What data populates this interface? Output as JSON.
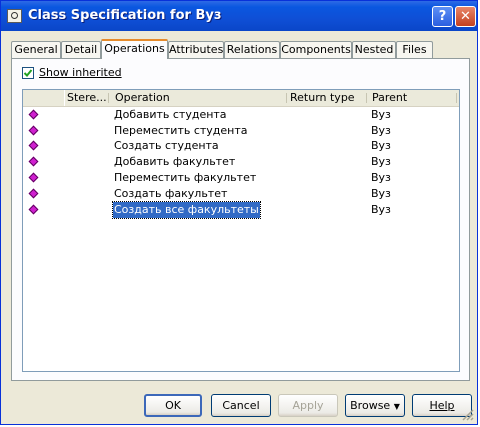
{
  "window": {
    "title": "Class Specification for Вуз"
  },
  "tabs": [
    {
      "label": "General"
    },
    {
      "label": "Detail"
    },
    {
      "label": "Operations"
    },
    {
      "label": "Attributes"
    },
    {
      "label": "Relations"
    },
    {
      "label": "Components"
    },
    {
      "label": "Nested"
    },
    {
      "label": "Files"
    }
  ],
  "active_tab": "Operations",
  "show_inherited": {
    "label": "Show inherited",
    "checked": true
  },
  "table": {
    "columns": [
      "Stere...",
      "Operation",
      "Return type",
      "Parent"
    ],
    "rows": [
      {
        "stereotype": "",
        "operation": "Добавить студента",
        "return_type": "",
        "parent": "Вуз"
      },
      {
        "stereotype": "",
        "operation": "Переместить студента",
        "return_type": "",
        "parent": "Вуз"
      },
      {
        "stereotype": "",
        "operation": "Создать студента",
        "return_type": "",
        "parent": "Вуз"
      },
      {
        "stereotype": "",
        "operation": "Добавить факультет",
        "return_type": "",
        "parent": "Вуз"
      },
      {
        "stereotype": "",
        "operation": "Переместить факультет",
        "return_type": "",
        "parent": "Вуз"
      },
      {
        "stereotype": "",
        "operation": "Создать факультет",
        "return_type": "",
        "parent": "Вуз"
      },
      {
        "stereotype": "",
        "operation": "Создать все факультеты",
        "return_type": "",
        "parent": "Вуз",
        "selected": true
      }
    ]
  },
  "buttons": {
    "ok": "OK",
    "cancel": "Cancel",
    "apply": "Apply",
    "browse": "Browse",
    "help": "Help"
  },
  "icons": {
    "operation": "operation-diamond-icon",
    "checkbox": "checkmark-icon"
  },
  "colors": {
    "titlebar": "#0a57e0",
    "selection": "#316ac5",
    "operation_icon": "#d020d0",
    "active_tab_accent": "#e68b2c"
  }
}
